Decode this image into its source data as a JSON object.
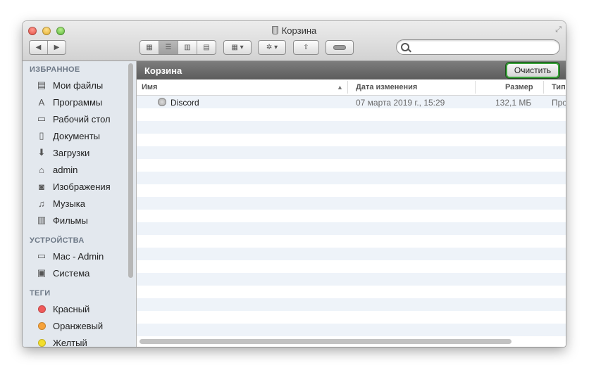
{
  "window": {
    "title": "Корзина"
  },
  "toolbar": {
    "nav_back": "◀",
    "nav_forward": "▶",
    "view_icons": [
      "icon-view-icon",
      "list-view-icon",
      "column-view-icon",
      "coverflow-view-icon"
    ],
    "arrange_icon": "▦ ▾",
    "action_icon": "✲ ▾",
    "share_icon": "⇧",
    "search": {
      "placeholder": "",
      "value": ""
    }
  },
  "sidebar": {
    "sections": [
      {
        "title": "ИЗБРАННОЕ",
        "items": [
          {
            "label": "Мои файлы",
            "icon": "all-files-icon",
            "glyph": "▤"
          },
          {
            "label": "Программы",
            "icon": "applications-icon",
            "glyph": "A"
          },
          {
            "label": "Рабочий стол",
            "icon": "desktop-icon",
            "glyph": "▭"
          },
          {
            "label": "Документы",
            "icon": "documents-icon",
            "glyph": "▯"
          },
          {
            "label": "Загрузки",
            "icon": "downloads-icon",
            "glyph": "⬇"
          },
          {
            "label": "admin",
            "icon": "home-icon",
            "glyph": "⌂"
          },
          {
            "label": "Изображения",
            "icon": "camera-icon",
            "glyph": "◙"
          },
          {
            "label": "Музыка",
            "icon": "music-icon",
            "glyph": "♫"
          },
          {
            "label": "Фильмы",
            "icon": "film-icon",
            "glyph": "▥"
          }
        ]
      },
      {
        "title": "УСТРОЙСТВА",
        "items": [
          {
            "label": "Mac - Admin",
            "icon": "computer-icon",
            "glyph": "▭"
          },
          {
            "label": "Система",
            "icon": "disk-icon",
            "glyph": "▣"
          }
        ]
      },
      {
        "title": "ТЕГИ",
        "items": [
          {
            "label": "Красный",
            "color": "#f05a5a"
          },
          {
            "label": "Оранжевый",
            "color": "#f7a33b"
          },
          {
            "label": "Желтый",
            "color": "#f3de2c"
          }
        ]
      }
    ]
  },
  "pathbar": {
    "title": "Корзина",
    "empty_button": "Очистить"
  },
  "columns": {
    "name": "Имя",
    "sort_indicator": "▲",
    "date": "Дата изменения",
    "size": "Размер",
    "kind": "Тип"
  },
  "files": [
    {
      "name": "Discord",
      "date": "07 марта 2019 г., 15:29",
      "size": "132,1 МБ",
      "kind": "Про"
    }
  ]
}
